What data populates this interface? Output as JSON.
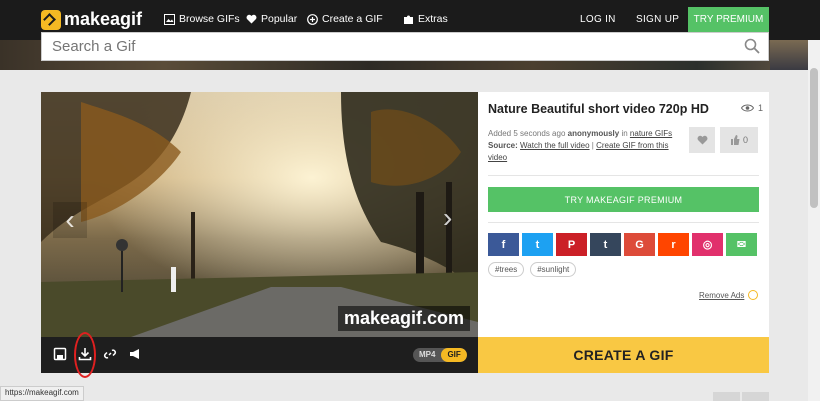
{
  "brand": {
    "name": "makeagif"
  },
  "nav": {
    "items": [
      {
        "label": "Browse GIFs",
        "icon": "image-icon"
      },
      {
        "label": "Popular",
        "icon": "heart-icon"
      },
      {
        "label": "Create a GIF",
        "icon": "plus-circle-icon"
      },
      {
        "label": "Extras",
        "icon": "puzzle-icon"
      }
    ],
    "login": "LOG IN",
    "signup": "SIGN UP",
    "premium": "TRY PREMIUM"
  },
  "search": {
    "placeholder": "Search a Gif"
  },
  "gif": {
    "title": "Nature Beautiful short video 720p HD",
    "views": "1",
    "added_prefix": "Added 5 seconds ago",
    "added_by": "anonymously",
    "in_word": "in",
    "category": "nature GIFs",
    "source_label": "Source:",
    "source_link": "Watch the full video",
    "separator": "|",
    "create_from_video": "Create GIF from this video",
    "likes": "0",
    "watermark": "makeagif.com"
  },
  "premium_cta": "TRY MAKEAGIF PREMIUM",
  "social": [
    {
      "name": "facebook",
      "glyph": "f",
      "color": "#3b5998"
    },
    {
      "name": "twitter",
      "glyph": "t",
      "color": "#1da1f2"
    },
    {
      "name": "pinterest",
      "glyph": "P",
      "color": "#cb2027"
    },
    {
      "name": "tumblr",
      "glyph": "t",
      "color": "#35465c"
    },
    {
      "name": "google",
      "glyph": "G",
      "color": "#dd4b39"
    },
    {
      "name": "reddit",
      "glyph": "r",
      "color": "#ff4500"
    },
    {
      "name": "instagram",
      "glyph": "◎",
      "color": "#e1306c"
    },
    {
      "name": "email",
      "glyph": "✉",
      "color": "#55c266"
    }
  ],
  "tags": [
    "#trees",
    "#sunlight"
  ],
  "remove_ads": "Remove Ads",
  "format": {
    "mp4": "MP4",
    "gif": "GIF"
  },
  "create_gif": "CREATE A GIF",
  "status_url": "https://makeagif.com"
}
